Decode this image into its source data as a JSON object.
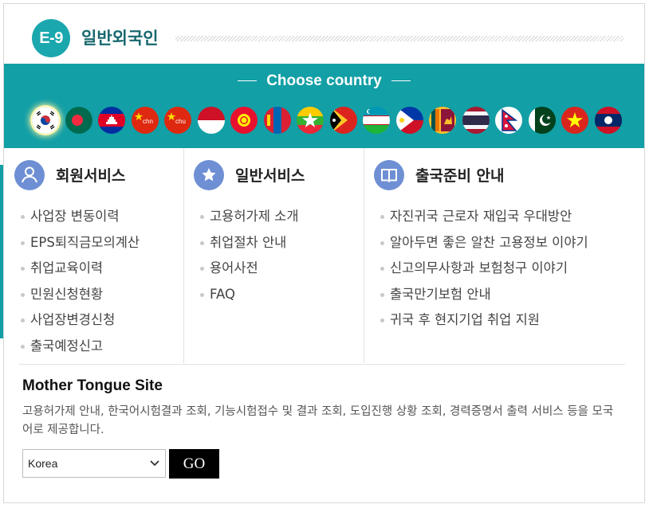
{
  "header": {
    "badge": "E-9",
    "title": "일반외국인"
  },
  "country_band": {
    "title": "Choose country",
    "flags": [
      {
        "icon": "flag-korea-icon",
        "selected": true
      },
      {
        "icon": "flag-bangladesh-icon"
      },
      {
        "icon": "flag-cambodia-icon"
      },
      {
        "icon": "flag-china-chn-icon"
      },
      {
        "icon": "flag-china-chu-icon"
      },
      {
        "icon": "flag-indonesia-icon"
      },
      {
        "icon": "flag-kyrgyzstan-icon"
      },
      {
        "icon": "flag-mongolia-icon"
      },
      {
        "icon": "flag-myanmar-icon"
      },
      {
        "icon": "flag-timor-leste-icon"
      },
      {
        "icon": "flag-uzbekistan-icon"
      },
      {
        "icon": "flag-philippines-icon"
      },
      {
        "icon": "flag-sri-lanka-icon"
      },
      {
        "icon": "flag-thailand-icon"
      },
      {
        "icon": "flag-nepal-icon"
      },
      {
        "icon": "flag-pakistan-icon"
      },
      {
        "icon": "flag-vietnam-icon"
      },
      {
        "icon": "flag-laos-icon"
      }
    ],
    "flag_text": {
      "chn": "chn",
      "chu": "chu"
    }
  },
  "columns": [
    {
      "icon": "user-icon",
      "title": "회원서비스",
      "items": [
        "사업장 변동이력",
        "EPS퇴직금모의계산",
        "취업교육이력",
        "민원신청현황",
        "사업장변경신청",
        "출국예정신고"
      ]
    },
    {
      "icon": "star-icon",
      "title": "일반서비스",
      "items": [
        "고용허가제 소개",
        "취업절차 안내",
        "용어사전",
        "FAQ"
      ]
    },
    {
      "icon": "book-icon",
      "title": "출국준비 안내",
      "items": [
        "자진귀국 근로자 재입국 우대방안",
        "알아두면 좋은 알찬 고용정보 이야기",
        "신고의무사항과 보험청구 이야기",
        "출국만기보험 안내",
        "귀국 후 현지기업 취업 지원"
      ]
    }
  ],
  "mother_tongue": {
    "title": "Mother Tongue Site",
    "description": "고용허가제 안내, 한국어시험결과 조회, 기능시험접수 및 결과 조회, 도입진행 상황 조회, 경력증명서 출력 서비스 등을 모국어로 제공합니다.",
    "select_value": "Korea",
    "go_label": "GO"
  },
  "colors": {
    "accent": "#129fa6",
    "title_text": "#17686f",
    "icon_bg": "#6e8fd4",
    "go_button": "#000000"
  }
}
